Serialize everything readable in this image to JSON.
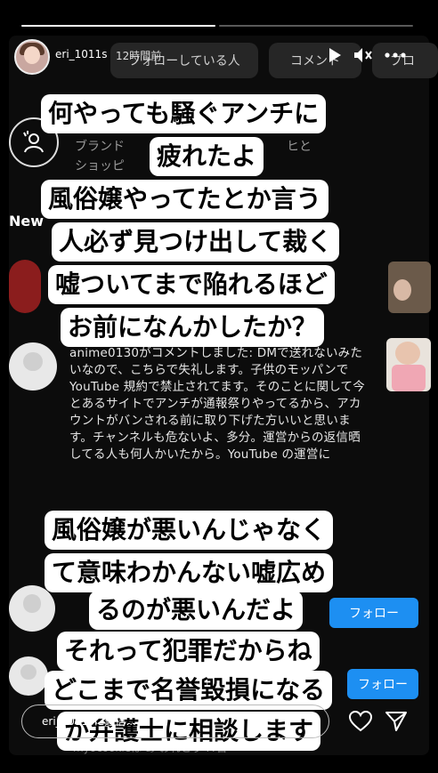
{
  "progress": {
    "segments": 2,
    "current_fill": 1.0,
    "next_fill": 0.0
  },
  "header": {
    "username": "eri_1011s",
    "time_ago": "12時間前",
    "play_icon": "play-icon",
    "mute_icon": "mute-icon",
    "more_icon": "more-icon"
  },
  "bg": {
    "tabs": [
      "フォローしている人",
      "コメント",
      "プロ"
    ],
    "brand_line1": "ブランド",
    "brand_line2": "ショッピ",
    "brand_right": "ヒと",
    "news_label": "New",
    "dm_text": "anime0130がコメントしました: DMで送れないみたいなので、こちらで失礼します。子供のモッパンで YouTube 規約で禁止されてます。そのことに関して今とあるサイトでアンチが通報祭りやってるから、アカウントがバンされる前に取り下げた方いいと思います。チャンネルも危ないよ、多分。運営からの返信晒してる人も何人かいたから。YouTube の運営に",
    "follow1": "フォロー",
    "follow2": "フォロー",
    "bottom_bg_text": "myocookieは あ おれとう ??日"
  },
  "captions": {
    "c1": "何やっても騒ぐアンチに",
    "c2": "疲れたよ",
    "c3": "風俗嬢やってたとか言う",
    "c4": "人必ず見つけ出して裁く",
    "c5": "嘘ついてまで陥れるほど",
    "c6": "お前になんかしたか？",
    "c7": "風俗嬢が悪いんじゃなく",
    "c8": "て意味わかんない嘘広め",
    "c9": "るのが悪いんだよ",
    "c10": "それって犯罪だからね",
    "c11": "どこまで名誉毀損になる",
    "c12": "か弁護士に相談します"
  },
  "footer": {
    "reply_placeholder": "eri_1011sに返信...",
    "heart_icon": "heart-icon",
    "send_icon": "send-icon"
  }
}
